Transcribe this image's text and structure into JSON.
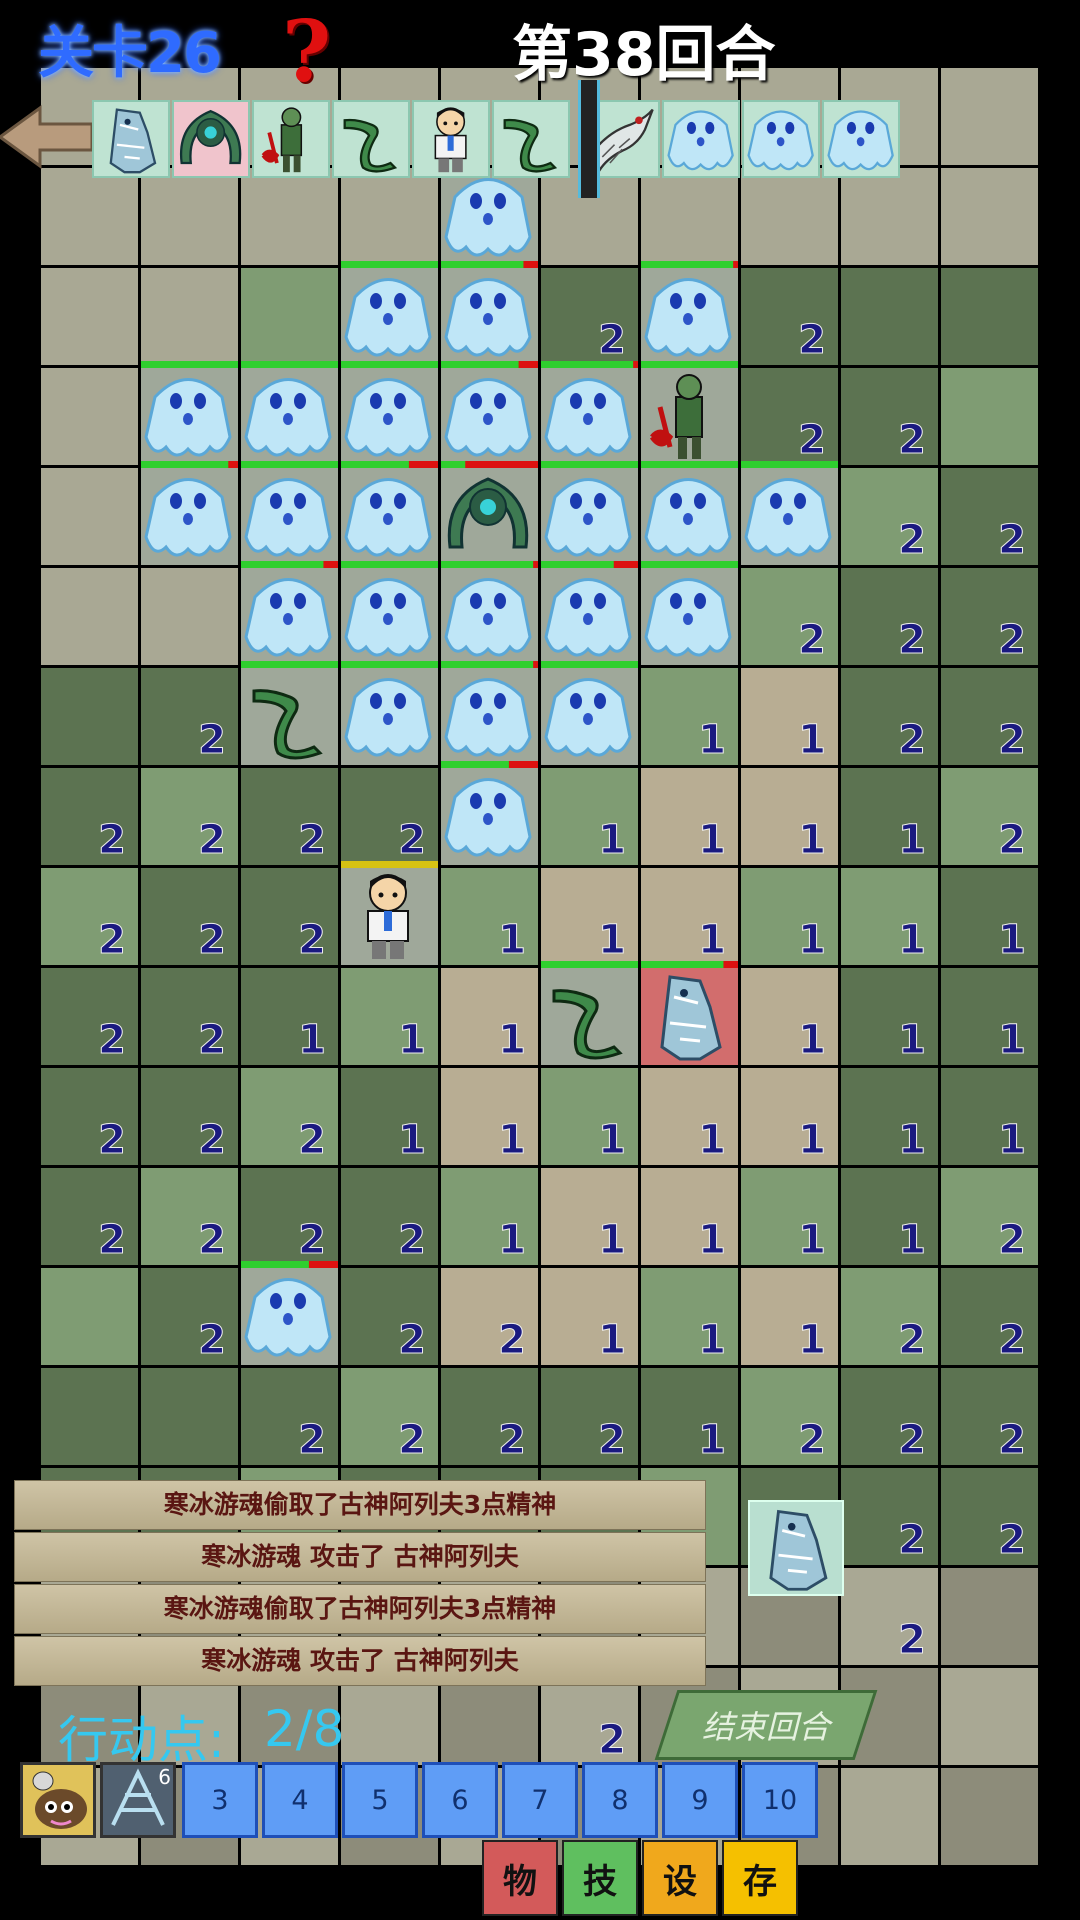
{
  "header": {
    "level_label": "关卡26",
    "help_icon": "question-mark-icon",
    "round_label": "第38回合",
    "back_icon": "back-arrow-icon"
  },
  "turn_queue": [
    "ice-golem",
    "green-ai-construct",
    "zombie-axe",
    "boomerang",
    "player-boy",
    "boomerang",
    "divider",
    "bone-wraith",
    "ice-ghost",
    "ice-ghost",
    "ice-ghost"
  ],
  "grid": {
    "rows": [
      "..........",
      "....2.....",
      "...22.2...",
      "......22..",
      "........22",
      ".......222",
      "..2...1122",
      "222.2.11112",
      "222.2.11111",
      "22.1.1.1.1",
      "2221.1111112",
      "2222.1111112",
      "2222....2",
      "..2222.122222",
      ".......222",
      ".......2",
      "....2",
      "......."
    ],
    "cells": [
      [
        1,
        4,
        "2"
      ],
      [
        2,
        5,
        "2"
      ],
      [
        2,
        7,
        "2"
      ],
      [
        3,
        7,
        "2"
      ],
      [
        3,
        8,
        "2"
      ],
      [
        4,
        8,
        "2"
      ],
      [
        4,
        9,
        "2"
      ],
      [
        5,
        7,
        "2"
      ],
      [
        5,
        8,
        "2"
      ],
      [
        5,
        9,
        "2"
      ],
      [
        6,
        1,
        "2"
      ],
      [
        6,
        6,
        "1"
      ],
      [
        6,
        7,
        "1"
      ],
      [
        6,
        8,
        "2"
      ],
      [
        6,
        9,
        "2"
      ],
      [
        7,
        0,
        "2"
      ],
      [
        7,
        1,
        "2"
      ],
      [
        7,
        2,
        "2"
      ],
      [
        7,
        3,
        "2"
      ],
      [
        7,
        5,
        "1"
      ],
      [
        7,
        6,
        "1"
      ],
      [
        7,
        7,
        "1"
      ],
      [
        7,
        8,
        "1"
      ],
      [
        7,
        9,
        "2"
      ],
      [
        8,
        0,
        "2"
      ],
      [
        8,
        1,
        "2"
      ],
      [
        8,
        2,
        "2"
      ],
      [
        8,
        4,
        "1"
      ],
      [
        8,
        5,
        "1"
      ],
      [
        8,
        6,
        "1"
      ],
      [
        8,
        7,
        "1"
      ],
      [
        8,
        8,
        "1"
      ],
      [
        8,
        9,
        "1"
      ],
      [
        9,
        0,
        "2"
      ],
      [
        9,
        1,
        "2"
      ],
      [
        9,
        2,
        "1"
      ],
      [
        9,
        3,
        "1"
      ],
      [
        9,
        4,
        "1"
      ],
      [
        9,
        7,
        "1"
      ],
      [
        9,
        8,
        "1"
      ],
      [
        9,
        9,
        "1"
      ],
      [
        10,
        0,
        "2"
      ],
      [
        10,
        1,
        "2"
      ],
      [
        10,
        2,
        "2"
      ],
      [
        10,
        3,
        "1"
      ],
      [
        10,
        4,
        "1"
      ],
      [
        10,
        5,
        "1"
      ],
      [
        10,
        6,
        "1"
      ],
      [
        10,
        7,
        "1"
      ],
      [
        10,
        8,
        "1"
      ],
      [
        10,
        9,
        "1"
      ],
      [
        11,
        0,
        "2"
      ],
      [
        11,
        1,
        "2"
      ],
      [
        11,
        2,
        "2"
      ],
      [
        11,
        3,
        "2"
      ],
      [
        11,
        4,
        "1"
      ],
      [
        11,
        5,
        "1"
      ],
      [
        11,
        6,
        "1"
      ],
      [
        11,
        7,
        "1"
      ],
      [
        11,
        8,
        "1"
      ],
      [
        11,
        9,
        "2"
      ],
      [
        12,
        1,
        "2"
      ],
      [
        12,
        3,
        "2"
      ],
      [
        12,
        4,
        "2"
      ],
      [
        12,
        5,
        "1"
      ],
      [
        12,
        6,
        "1"
      ],
      [
        12,
        7,
        "1"
      ],
      [
        12,
        8,
        "2"
      ],
      [
        12,
        9,
        "2"
      ],
      [
        13,
        2,
        "2"
      ],
      [
        13,
        3,
        "2"
      ],
      [
        13,
        4,
        "2"
      ],
      [
        13,
        5,
        "2"
      ],
      [
        13,
        6,
        "1"
      ],
      [
        13,
        7,
        "2"
      ],
      [
        13,
        8,
        "2"
      ],
      [
        13,
        9,
        "2"
      ],
      [
        14,
        8,
        "2"
      ],
      [
        14,
        9,
        "2"
      ],
      [
        15,
        8,
        "2"
      ],
      [
        16,
        5,
        "2"
      ]
    ]
  },
  "units": [
    {
      "row": 1,
      "col": 4,
      "kind": "ice-ghost",
      "hp": 0
    },
    {
      "row": 2,
      "col": 3,
      "kind": "ice-ghost",
      "hp": 1
    },
    {
      "row": 2,
      "col": 4,
      "kind": "ice-ghost",
      "hp": 0.85
    },
    {
      "row": 2,
      "col": 6,
      "kind": "ice-ghost",
      "hp": 0.95
    },
    {
      "row": 3,
      "col": 1,
      "kind": "ice-ghost",
      "hp": 1
    },
    {
      "row": 3,
      "col": 2,
      "kind": "ice-ghost",
      "hp": 1
    },
    {
      "row": 3,
      "col": 3,
      "kind": "ice-ghost",
      "hp": 1
    },
    {
      "row": 3,
      "col": 4,
      "kind": "ice-ghost",
      "hp": 0.8
    },
    {
      "row": 3,
      "col": 5,
      "kind": "ice-ghost",
      "hp": 0.95
    },
    {
      "row": 3,
      "col": 6,
      "kind": "zombie-axe",
      "hp": 1
    },
    {
      "row": 4,
      "col": 1,
      "kind": "ice-ghost",
      "hp": 0.9
    },
    {
      "row": 4,
      "col": 2,
      "kind": "ice-ghost",
      "hp": 1
    },
    {
      "row": 4,
      "col": 3,
      "kind": "ice-ghost",
      "hp": 0.7
    },
    {
      "row": 4,
      "col": 4,
      "kind": "green-ai-construct",
      "hp": 0.25
    },
    {
      "row": 4,
      "col": 5,
      "kind": "ice-ghost",
      "hp": 1
    },
    {
      "row": 4,
      "col": 6,
      "kind": "ice-ghost",
      "hp": 1
    },
    {
      "row": 4,
      "col": 7,
      "kind": "ice-ghost",
      "hp": 1
    },
    {
      "row": 5,
      "col": 2,
      "kind": "ice-ghost",
      "hp": 0.85
    },
    {
      "row": 5,
      "col": 3,
      "kind": "ice-ghost",
      "hp": 1
    },
    {
      "row": 5,
      "col": 4,
      "kind": "ice-ghost",
      "hp": 0.95
    },
    {
      "row": 5,
      "col": 5,
      "kind": "ice-ghost",
      "hp": 0.75
    },
    {
      "row": 5,
      "col": 6,
      "kind": "ice-ghost",
      "hp": 1
    },
    {
      "row": 6,
      "col": 2,
      "kind": "boomerang",
      "hp": 1
    },
    {
      "row": 6,
      "col": 3,
      "kind": "ice-ghost",
      "hp": 1
    },
    {
      "row": 6,
      "col": 4,
      "kind": "ice-ghost",
      "hp": 0.95
    },
    {
      "row": 6,
      "col": 5,
      "kind": "ice-ghost",
      "hp": 1
    },
    {
      "row": 7,
      "col": 4,
      "kind": "ice-ghost",
      "hp": 0.7
    },
    {
      "row": 8,
      "col": 3,
      "kind": "player-boy",
      "hp": 1
    },
    {
      "row": 9,
      "col": 5,
      "kind": "boomerang",
      "hp": 1
    },
    {
      "row": 9,
      "col": 6,
      "kind": "ice-golem",
      "hp": 0.85
    },
    {
      "row": 12,
      "col": 2,
      "kind": "ice-ghost",
      "hp": 0.7
    }
  ],
  "log": [
    "寒冰游魂偷取了古神阿列夫3点精神",
    "寒冰游魂 攻击了 古神阿列夫",
    "寒冰游魂偷取了古神阿列夫3点精神",
    "寒冰游魂 攻击了 古神阿列夫"
  ],
  "selected_unit_icon": "ice-golem",
  "action_points": {
    "label": "行动点:",
    "value": "2/8",
    "current": 2,
    "max": 8
  },
  "end_turn_label": "结束回合",
  "hotbar": {
    "skill_icons": [
      "lightbulb-creature-icon",
      "frost-skill-icon"
    ],
    "skill_badge": "6",
    "slots": [
      "3",
      "4",
      "5",
      "6",
      "7",
      "8",
      "9",
      "10"
    ]
  },
  "menu": [
    {
      "label": "物",
      "color": "#d35a5a"
    },
    {
      "label": "技",
      "color": "#5fbf5f"
    },
    {
      "label": "设",
      "color": "#f0a81c"
    },
    {
      "label": "存",
      "color": "#f5c000"
    }
  ],
  "colors": {
    "tile_gray": "#a9a894",
    "tile_dark_green": "#5c7351",
    "tile_light_green": "#7f9c73",
    "tile_sand": "#b8ad93",
    "number": "#1a1a80",
    "hud_blue": "#35c8f0"
  }
}
